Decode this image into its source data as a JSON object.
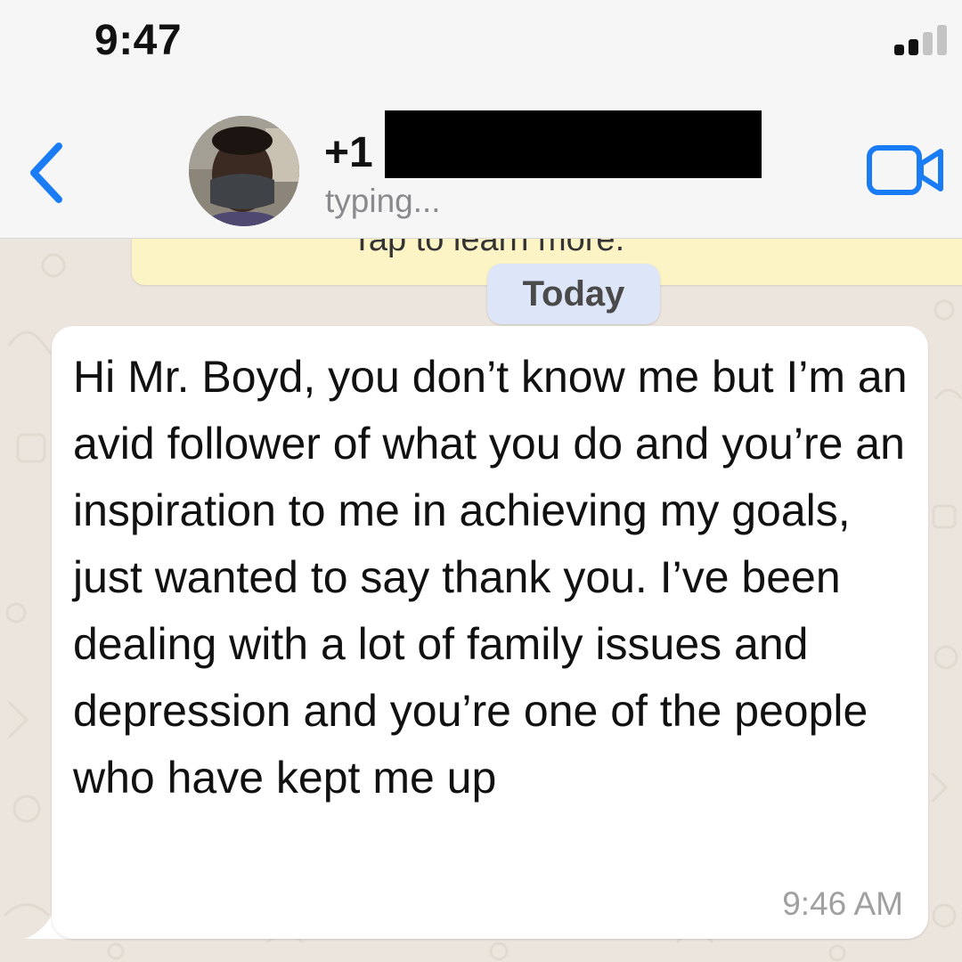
{
  "status_bar": {
    "time": "9:47",
    "signal_icon": "signal-bars-icon"
  },
  "header": {
    "back_icon": "chevron-left-icon",
    "contact_name": "+1",
    "status": "typing...",
    "video_icon": "video-call-icon",
    "accent_color": "#1a7cf4"
  },
  "chat": {
    "notice_text": "Tap to learn more.",
    "date_label": "Today",
    "message": {
      "text": "Hi Mr. Boyd, you don’t know me but I’m an avid follower of what you do and you’re an inspiration to me in achieving my goals, just wanted to say thank you. I’ve been dealing with a lot of family issues and depression and you’re one of the people who have kept me up",
      "time": "9:46 AM"
    }
  }
}
